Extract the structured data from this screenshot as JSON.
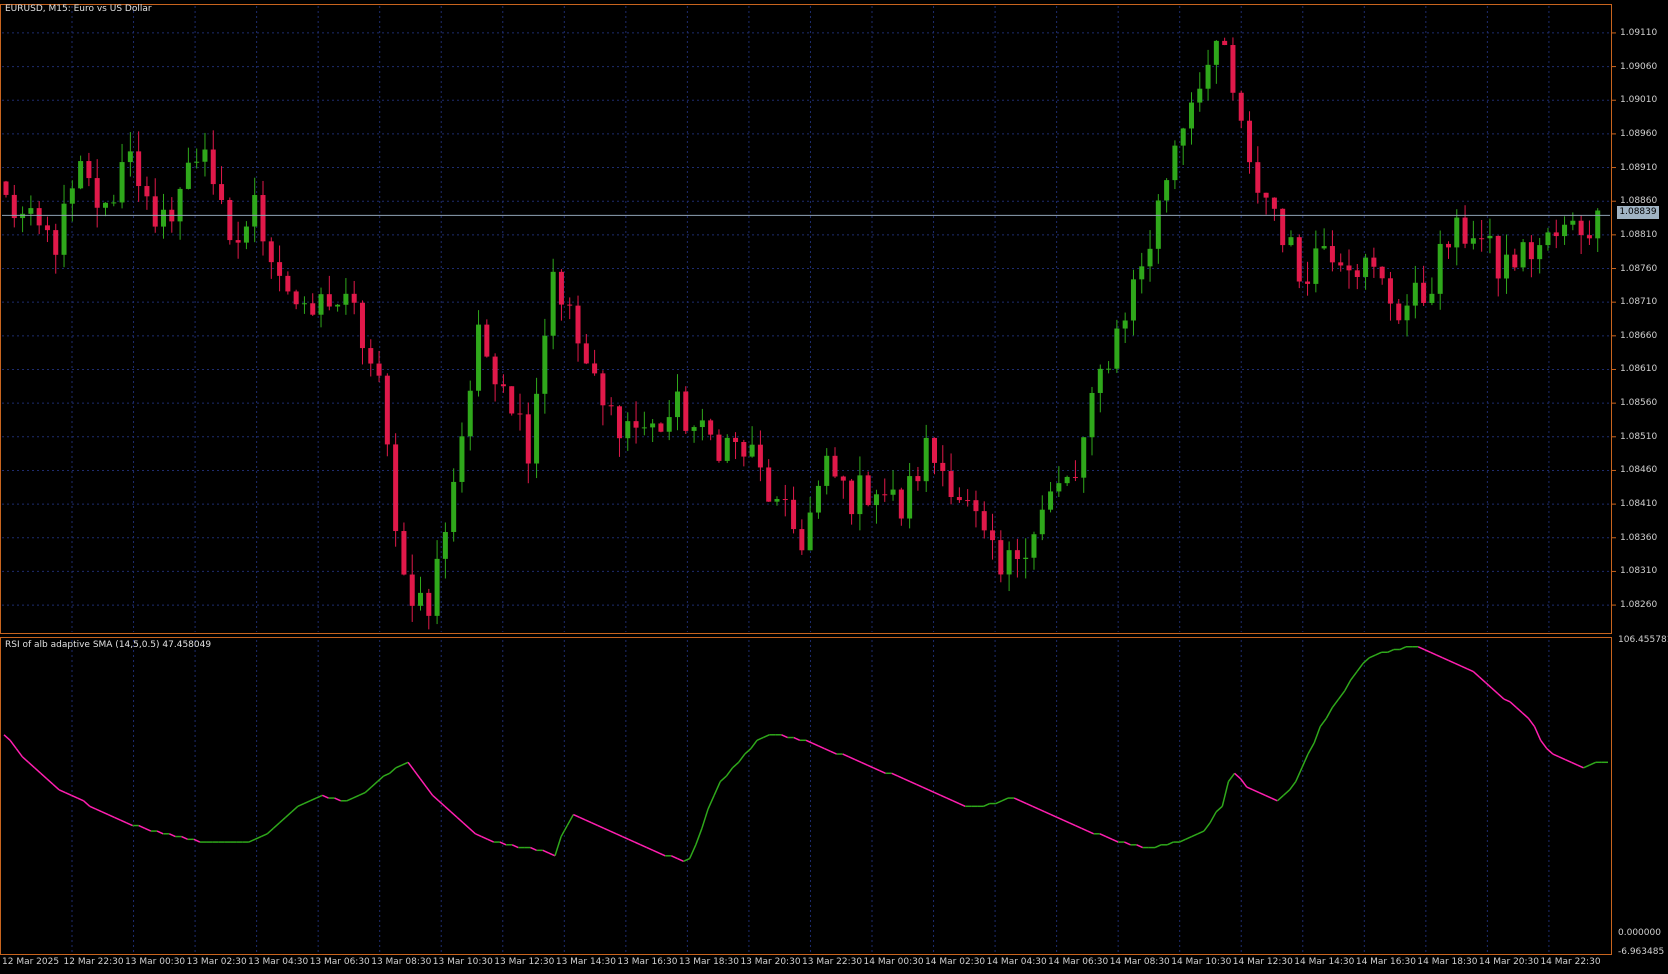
{
  "chart_title": "EURUSD, M15:  Euro vs US Dollar",
  "indicator_title": "RSI of alb adaptive SMA (14,5,0.5) 47.458049",
  "current_price": "1.08839",
  "colors": {
    "background": "#000000",
    "frame": "#c8641e",
    "grid": "#1e2c6e",
    "bull": "#2fa81b",
    "bear": "#e0194a",
    "rsi_up": "#2fa81b",
    "rsi_down": "#ff1fb0",
    "price_line": "#8fa3b4"
  },
  "chart_data": [
    {
      "type": "candlestick",
      "price_ticks": [
        "1.09110",
        "1.09060",
        "1.09010",
        "1.08960",
        "1.08910",
        "1.08860",
        "1.08810",
        "1.08760",
        "1.08710",
        "1.08660",
        "1.08610",
        "1.08560",
        "1.08510",
        "1.08460",
        "1.08410",
        "1.08360",
        "1.08310",
        "1.08260"
      ],
      "ylim": [
        1.0822,
        1.0915
      ],
      "current_price": 1.08839,
      "anchors": [
        [
          0,
          1.0886
        ],
        [
          3,
          1.0882
        ],
        [
          6,
          1.088
        ],
        [
          9,
          1.089
        ],
        [
          12,
          1.0884
        ],
        [
          15,
          1.0895
        ],
        [
          18,
          1.088
        ],
        [
          21,
          1.0888
        ],
        [
          24,
          1.0895
        ],
        [
          27,
          1.0878
        ],
        [
          30,
          1.0885
        ],
        [
          33,
          1.0876
        ],
        [
          36,
          1.0868
        ],
        [
          39,
          1.0872
        ],
        [
          42,
          1.0869
        ],
        [
          45,
          1.0858
        ],
        [
          48,
          1.083
        ],
        [
          51,
          1.0825
        ],
        [
          54,
          1.0845
        ],
        [
          57,
          1.0865
        ],
        [
          60,
          1.086
        ],
        [
          63,
          1.085
        ],
        [
          66,
          1.0876
        ],
        [
          69,
          1.0865
        ],
        [
          72,
          1.0855
        ],
        [
          75,
          1.0853
        ],
        [
          78,
          1.0852
        ],
        [
          81,
          1.0855
        ],
        [
          84,
          1.0851
        ],
        [
          87,
          1.085
        ],
        [
          90,
          1.0848
        ],
        [
          93,
          1.084
        ],
        [
          96,
          1.0836
        ],
        [
          99,
          1.0846
        ],
        [
          102,
          1.0842
        ],
        [
          105,
          1.0844
        ],
        [
          108,
          1.084
        ],
        [
          111,
          1.0849
        ],
        [
          114,
          1.0845
        ],
        [
          117,
          1.0838
        ],
        [
          120,
          1.083
        ],
        [
          123,
          1.0836
        ],
        [
          126,
          1.0842
        ],
        [
          129,
          1.0845
        ],
        [
          132,
          1.086
        ],
        [
          135,
          1.087
        ],
        [
          138,
          1.088
        ],
        [
          141,
          1.0895
        ],
        [
          144,
          1.0905
        ],
        [
          147,
          1.0908
        ],
        [
          150,
          1.089
        ],
        [
          153,
          1.0885
        ],
        [
          156,
          1.0875
        ],
        [
          159,
          1.088
        ],
        [
          162,
          1.0878
        ],
        [
          165,
          1.0875
        ],
        [
          168,
          1.087
        ],
        [
          171,
          1.0872
        ],
        [
          174,
          1.088
        ],
        [
          177,
          1.0882
        ],
        [
          180,
          1.0876
        ],
        [
          183,
          1.0878
        ],
        [
          186,
          1.088
        ],
        [
          189,
          1.0882
        ],
        [
          192,
          1.0883
        ]
      ],
      "candle_count": 193
    },
    {
      "type": "line",
      "name": "RSI of alb adaptive SMA (14,5,0.5)",
      "value_ticks": [
        "106.455781",
        "0.000000",
        "-6.963485"
      ],
      "ylim": [
        -6.963485,
        106.455781
      ],
      "values": [
        72,
        70,
        67,
        64,
        62,
        60,
        58,
        56,
        54,
        52,
        51,
        50,
        49,
        48,
        46,
        45,
        44,
        43,
        42,
        41,
        40,
        39,
        39,
        38,
        37,
        37,
        36,
        36,
        35,
        35,
        34,
        34,
        33,
        33,
        33,
        33,
        33,
        33,
        33,
        33,
        33,
        34,
        35,
        36,
        38,
        40,
        42,
        44,
        46,
        47,
        48,
        49,
        50,
        49,
        49,
        48,
        48,
        49,
        50,
        51,
        53,
        55,
        57,
        58,
        60,
        61,
        62,
        59,
        56,
        53,
        50,
        48,
        46,
        44,
        42,
        40,
        38,
        36,
        35,
        34,
        33,
        33,
        32,
        32,
        31,
        31,
        31,
        30,
        30,
        29,
        28,
        35,
        39,
        43,
        42,
        41,
        40,
        39,
        38,
        37,
        36,
        35,
        34,
        33,
        32,
        31,
        30,
        29,
        28,
        28,
        27,
        26,
        27,
        32,
        38,
        45,
        50,
        55,
        57,
        60,
        62,
        65,
        67,
        70,
        71,
        72,
        72,
        72,
        71,
        71,
        70,
        70,
        69,
        68,
        67,
        66,
        65,
        65,
        64,
        63,
        62,
        61,
        60,
        59,
        58,
        58,
        57,
        56,
        55,
        54,
        53,
        52,
        51,
        50,
        49,
        48,
        47,
        46,
        46,
        46,
        46,
        47,
        47,
        48,
        49,
        49,
        48,
        47,
        46,
        45,
        44,
        43,
        42,
        41,
        40,
        39,
        38,
        37,
        36,
        36,
        35,
        34,
        33,
        33,
        32,
        32,
        31,
        31,
        31,
        32,
        32,
        33,
        33,
        34,
        35,
        36,
        37,
        40,
        44,
        46,
        55,
        58,
        56,
        53,
        52,
        51,
        50,
        49,
        48,
        50,
        52,
        55,
        60,
        65,
        69,
        75,
        78,
        82,
        85,
        88,
        92,
        95,
        98,
        100,
        101,
        102,
        102,
        103,
        103,
        104,
        104,
        104,
        103,
        102,
        101,
        100,
        99,
        98,
        97,
        96,
        95,
        93,
        91,
        89,
        87,
        85,
        84,
        82,
        80,
        78,
        75,
        70,
        67,
        65,
        64,
        63,
        62,
        61,
        60,
        61,
        62,
        62,
        62
      ]
    }
  ],
  "time_labels": [
    "12 Mar 2025",
    "12 Mar 22:30",
    "13 Mar 00:30",
    "13 Mar 02:30",
    "13 Mar 04:30",
    "13 Mar 06:30",
    "13 Mar 08:30",
    "13 Mar 10:30",
    "13 Mar 12:30",
    "13 Mar 14:30",
    "13 Mar 16:30",
    "13 Mar 18:30",
    "13 Mar 20:30",
    "13 Mar 22:30",
    "14 Mar 00:30",
    "14 Mar 02:30",
    "14 Mar 04:30",
    "14 Mar 06:30",
    "14 Mar 08:30",
    "14 Mar 10:30",
    "14 Mar 12:30",
    "14 Mar 14:30",
    "14 Mar 16:30",
    "14 Mar 18:30",
    "14 Mar 20:30",
    "14 Mar 22:30"
  ]
}
